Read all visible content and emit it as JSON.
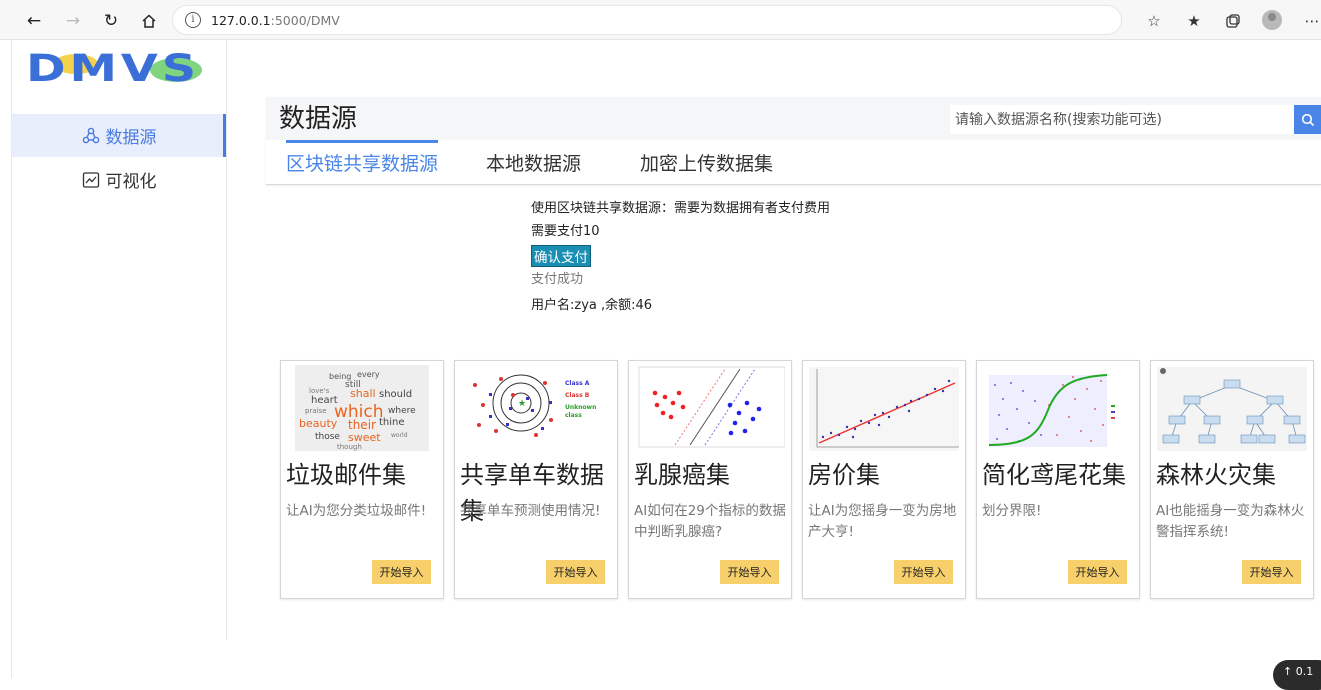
{
  "browser": {
    "url_host": "127.0.0.1",
    "url_path": ":5000/DMV"
  },
  "app": {
    "logo_text": "DMVS",
    "colors": {
      "accent": "#4a86e8",
      "logo_blue": "#3b6fd8",
      "logo_green": "#7fd47f",
      "logo_yellow": "#f5d04a"
    }
  },
  "sidebar": {
    "items": [
      {
        "label": "数据源",
        "icon": "cloud-network-icon",
        "active": true
      },
      {
        "label": "可视化",
        "icon": "line-chart-icon",
        "active": false
      }
    ]
  },
  "header": {
    "title": "数据源",
    "search_placeholder": "请输入数据源名称(搜索功能可选)",
    "tabs": [
      {
        "label": "区块链共享数据源",
        "active": true
      },
      {
        "label": "本地数据源",
        "active": false
      },
      {
        "label": "加密上传数据集",
        "active": false
      }
    ]
  },
  "payment": {
    "notice": "使用区块链共享数据源：需要为数据拥有者支付费用",
    "amount": "需要支付10",
    "confirm_label": "确认支付",
    "status": "支付成功",
    "user_info": "用户名:zya ,余额:46"
  },
  "datasets": [
    {
      "title": "垃圾邮件集",
      "desc": "让AI为您分类垃圾邮件!",
      "button": "开始导入",
      "image": "word-cloud"
    },
    {
      "title": "共享单车数据集",
      "desc": "共享单车预测使用情况!",
      "button": "开始导入",
      "image": "class-scatter"
    },
    {
      "title": "乳腺癌集",
      "desc": "AI如何在29个指标的数据中判断乳腺癌?",
      "button": "开始导入",
      "image": "svm-margin"
    },
    {
      "title": "房价集",
      "desc": "让AI为您摇身一变为房地产大亨!",
      "button": "开始导入",
      "image": "linear-regression"
    },
    {
      "title": "简化鸢尾花集",
      "desc": "划分界限!",
      "button": "开始导入",
      "image": "logistic-regression"
    },
    {
      "title": "森林火灾集",
      "desc": "AI也能摇身一变为森林火警指挥系统!",
      "button": "开始导入",
      "image": "decision-tree"
    }
  ],
  "overlay": {
    "speed_label": "0.1"
  }
}
